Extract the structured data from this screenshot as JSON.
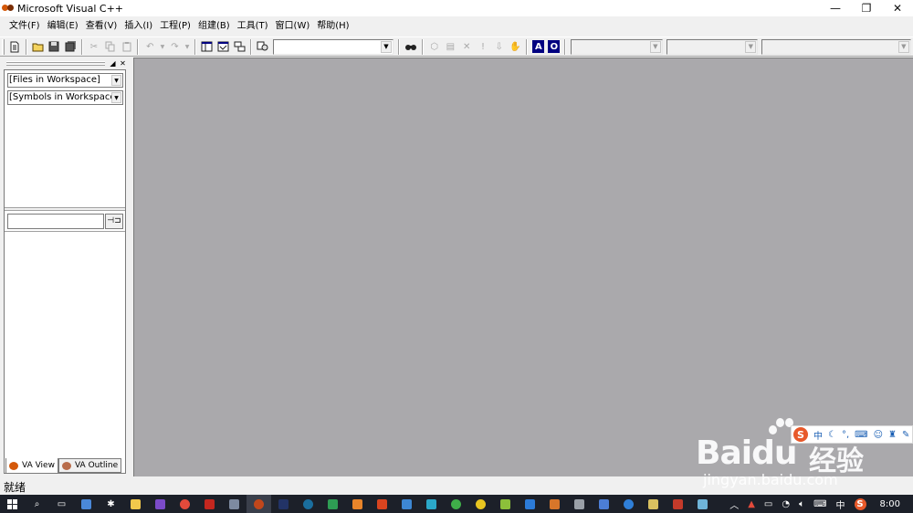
{
  "window": {
    "title": "Microsoft Visual C++",
    "minimize": "—",
    "restore": "❐",
    "close": "✕"
  },
  "menu": [
    "文件(F)",
    "编辑(E)",
    "查看(V)",
    "插入(I)",
    "工程(P)",
    "组建(B)",
    "工具(T)",
    "窗口(W)",
    "帮助(H)"
  ],
  "toolbar": {
    "blue_a": "A",
    "blue_o": "O"
  },
  "workspace": {
    "files_combo": "[Files in Workspace]",
    "symbols_combo": "[Symbols in Workspace]",
    "search_value": "",
    "pin_label": "⊣⊐",
    "tabs": [
      "VA View",
      "VA Outline"
    ]
  },
  "status": {
    "text": "就绪"
  },
  "ime": {
    "label": "中",
    "logo": "S"
  },
  "watermark": {
    "logo": "Bai",
    "logo_tail": "du",
    "cn": "经验",
    "url": "jingyan.baidu.com"
  },
  "taskbar": {
    "tray_ime": "中",
    "tray_sogou": "S",
    "clock": "8:00"
  },
  "colors": {
    "mdi_background": "#aaa9ac",
    "taskbar": "#1c2029",
    "selection_blue": "#000080"
  }
}
